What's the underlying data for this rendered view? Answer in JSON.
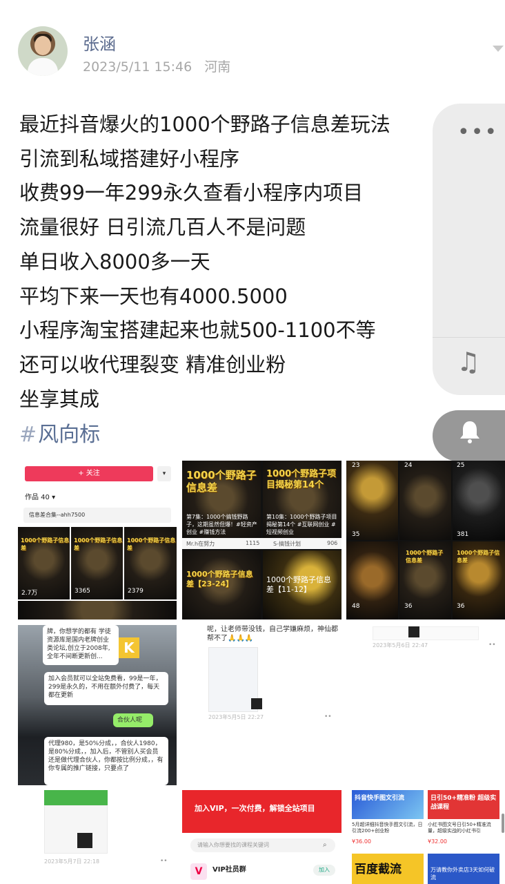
{
  "post": {
    "username": "张涵",
    "datetime": "2023/5/11 15:46",
    "location": "河南",
    "lines": [
      "最近抖音爆火的1000个野路子信息差玩法",
      "引流到私域搭建好小程序",
      "收费99一年299永久查看小程序内项目",
      "流量很好  日引流几百人不是问题",
      "单日收入8000多一天",
      "平均下来一天也有4000.5000",
      "小程序淘宝搭建起来也就500-1100不等",
      "还可以收代理裂变  精准创业粉",
      "坐享其成"
    ],
    "tag_hash": "#",
    "tag": "风向标"
  },
  "side_panel": {
    "more_icon": "more-icon",
    "music_icon": "music-note-icon",
    "bell_icon": "bell-icon",
    "moon_icon": "moon-icon"
  },
  "images": {
    "c1": {
      "follow_label": "+ 关注",
      "more_label": "▾",
      "works_label": "作品 40 ▾",
      "collection_label": "信息差合集--ahh7500",
      "tiles": [
        "1000个野路子信息差",
        "1000个野路子信息差",
        "1000个野路子信息差"
      ],
      "likes": [
        "2.7万",
        "3365",
        "2379"
      ]
    },
    "c2": {
      "title_a": "1000个野路子信息差",
      "title_b": "1000个野路子项目揭秘第14个",
      "caption_a": "第7集：1000个搞钱野路子，这期虽然但爆！#轻资产创业 #赚钱方法",
      "caption_b": "第10集：1000个野路子项目揭秘第14个 #互联网创业 #短视频创业",
      "author_a": "Mr.h在努力",
      "author_b": "S-搞钱计划",
      "likes_a": "1115",
      "likes_b": "906",
      "title_c": "1000个野路子信息差【23-24】",
      "title_d": "1000个野路子信息差【11-12】"
    },
    "c3": {
      "likes": [
        "23",
        "24",
        "25",
        "35",
        "381",
        "48",
        "36",
        "36"
      ],
      "title_a": "1000个野路子信息差",
      "title_b": "1000个野路子信息差"
    },
    "c4": {
      "bubble1": "牌，你想学的都有 学徒资源库是国内老牌创业类论坛,创立于2008年,全年不间断更新创...",
      "bubble2": "加入会员就可以全站免费看，99是一年，299是永久的，不用在额外付费了，每天都在更新",
      "reply": "合伙人呢",
      "bubble3": "代理980，是50%分成，，合伙人1980，是80%分成，，加入后，不管别人买会员还是做代理合伙人，你都按比例分成，，有你专属的推广链接，只要点了"
    },
    "c5": {
      "text": "呢，让老师带没钱，自己学嫌麻烦，神仙都帮不了🙏🙏🙏",
      "stamp": "2023年5月5日 22:27"
    },
    "c6": {
      "stamp": "2023年5月6日 22:47"
    },
    "c7": {
      "stamp": "2023年5月7日 22:18"
    },
    "c8": {
      "banner": "加入VIP，一次付费，解锁全站项目",
      "search_placeholder": "请输入你想要找的课程关键词",
      "vip_title": "VIP社员群",
      "join_btn": "加入"
    },
    "c9": {
      "card_a_title": "抖音快手图文引流",
      "card_a_desc": "5月超详细抖音快手图文引流，日引流200+创业粉",
      "card_a_price": "¥36.00",
      "card_b_title": "日引50+精准粉 超级实战课程",
      "card_b_desc": "小红书图文号日引50+精准流量，超级实战的小红书引",
      "card_b_price": "¥32.00",
      "card_c_title": "百度截流",
      "card_d_title": "万请教你外卖店3天如何破流"
    }
  },
  "colors": {
    "accent_name": "#5b6b8e",
    "tag": "#5a6f94",
    "follow": "#ee3a5b"
  }
}
